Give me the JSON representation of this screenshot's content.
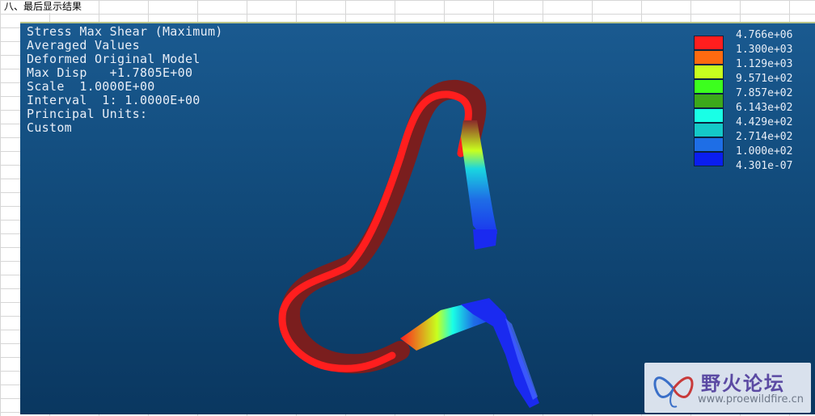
{
  "sheet": {
    "title": "八、最后显示结果"
  },
  "result_info": {
    "lines": [
      "Stress Max Shear (Maximum)",
      "Averaged Values",
      "Deformed Original Model",
      "Max Disp   +1.7805E+00",
      "Scale  1.0000E+00",
      "Interval  1: 1.0000E+00",
      "Principal Units:",
      "Custom"
    ]
  },
  "legend": {
    "labels": [
      "4.766e+06",
      "1.300e+03",
      "1.129e+03",
      "9.571e+02",
      "7.857e+02",
      "6.143e+02",
      "4.429e+02",
      "2.714e+02",
      "1.000e+02",
      "4.301e-07"
    ],
    "colors": [
      "#ff1e1e",
      "#ff6a10",
      "#c8ff1e",
      "#3cff1e",
      "#3ca81a",
      "#19ffe6",
      "#14c8c8",
      "#1e6ee6",
      "#0a1ef0"
    ]
  },
  "watermark": {
    "name": "野火论坛",
    "url": "www.proewildfire.cn"
  }
}
